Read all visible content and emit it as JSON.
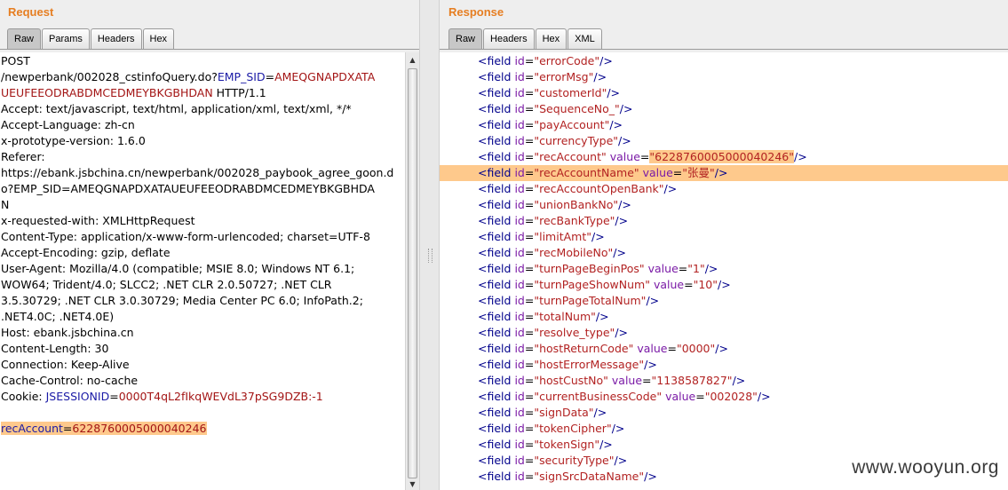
{
  "request": {
    "title": "Request",
    "tabs": [
      "Raw",
      "Params",
      "Headers",
      "Hex"
    ],
    "active_tab": "Raw",
    "lines": [
      [
        {
          "t": "POST"
        }
      ],
      [
        {
          "t": "/newperbank/002028_cstinfoQuery.do?"
        },
        {
          "t": "EMP_SID",
          "c": "k"
        },
        {
          "t": "="
        },
        {
          "t": "AMEQGNAPDXATA",
          "c": "v"
        }
      ],
      [
        {
          "t": "UEUFEEODRABDMCEDMEYBKGBHDAN",
          "c": "v"
        },
        {
          "t": " HTTP/1.1"
        }
      ],
      [
        {
          "t": "Accept: text/javascript, text/html, application/xml, text/xml, */*"
        }
      ],
      [
        {
          "t": "Accept-Language: zh-cn"
        }
      ],
      [
        {
          "t": "x-prototype-version: 1.6.0"
        }
      ],
      [
        {
          "t": "Referer:"
        }
      ],
      [
        {
          "t": "https://ebank.jsbchina.cn/newperbank/002028_paybook_agree_goon.d"
        }
      ],
      [
        {
          "t": "o?EMP_SID=AMEQGNAPDXATAUEUFEEODRABDMCEDMEYBKGBHDA"
        }
      ],
      [
        {
          "t": "N"
        }
      ],
      [
        {
          "t": "x-requested-with: XMLHttpRequest"
        }
      ],
      [
        {
          "t": "Content-Type: application/x-www-form-urlencoded; charset=UTF-8"
        }
      ],
      [
        {
          "t": "Accept-Encoding: gzip, deflate"
        }
      ],
      [
        {
          "t": "User-Agent: Mozilla/4.0 (compatible; MSIE 8.0; Windows NT 6.1;"
        }
      ],
      [
        {
          "t": "WOW64; Trident/4.0; SLCC2; .NET CLR 2.0.50727; .NET CLR"
        }
      ],
      [
        {
          "t": "3.5.30729; .NET CLR 3.0.30729; Media Center PC 6.0; InfoPath.2;"
        }
      ],
      [
        {
          "t": ".NET4.0C; .NET4.0E)"
        }
      ],
      [
        {
          "t": "Host: ebank.jsbchina.cn"
        }
      ],
      [
        {
          "t": "Content-Length: 30"
        }
      ],
      [
        {
          "t": "Connection: Keep-Alive"
        }
      ],
      [
        {
          "t": "Cache-Control: no-cache"
        }
      ],
      [
        {
          "t": "Cookie: "
        },
        {
          "t": "JSESSIONID",
          "c": "k"
        },
        {
          "t": "="
        },
        {
          "t": "0000T4qL2fIkqWEVdL37pSG9DZB:-1",
          "c": "v"
        }
      ],
      [],
      [
        {
          "t": "recAccount",
          "c": "k",
          "hl": true
        },
        {
          "t": "=",
          "hl": true
        },
        {
          "t": "6228760005000040246",
          "c": "v",
          "hl": true
        }
      ]
    ]
  },
  "response": {
    "title": "Response",
    "tabs": [
      "Raw",
      "Headers",
      "Hex",
      "XML"
    ],
    "active_tab": "Raw",
    "fields": [
      {
        "id": "errorCode"
      },
      {
        "id": "errorMsg"
      },
      {
        "id": "customerId"
      },
      {
        "id": "SequenceNo_"
      },
      {
        "id": "payAccount"
      },
      {
        "id": "currencyType"
      },
      {
        "id": "recAccount",
        "value": "6228760005000040246",
        "hl_value": true
      },
      {
        "id": "recAccountName",
        "value": "张曼",
        "hl_line": true
      },
      {
        "id": "recAccountOpenBank"
      },
      {
        "id": "unionBankNo"
      },
      {
        "id": "recBankType"
      },
      {
        "id": "limitAmt"
      },
      {
        "id": "recMobileNo"
      },
      {
        "id": "turnPageBeginPos",
        "value": "1"
      },
      {
        "id": "turnPageShowNum",
        "value": "10"
      },
      {
        "id": "turnPageTotalNum"
      },
      {
        "id": "totalNum"
      },
      {
        "id": "resolve_type"
      },
      {
        "id": "hostReturnCode",
        "value": "0000"
      },
      {
        "id": "hostErrorMessage"
      },
      {
        "id": "hostCustNo",
        "value": "1138587827"
      },
      {
        "id": "currentBusinessCode",
        "value": "002028"
      },
      {
        "id": "signData"
      },
      {
        "id": "tokenCipher"
      },
      {
        "id": "tokenSign"
      },
      {
        "id": "securityType"
      },
      {
        "id": "signSrcDataName"
      }
    ]
  },
  "watermark": "www.wooyun.org"
}
